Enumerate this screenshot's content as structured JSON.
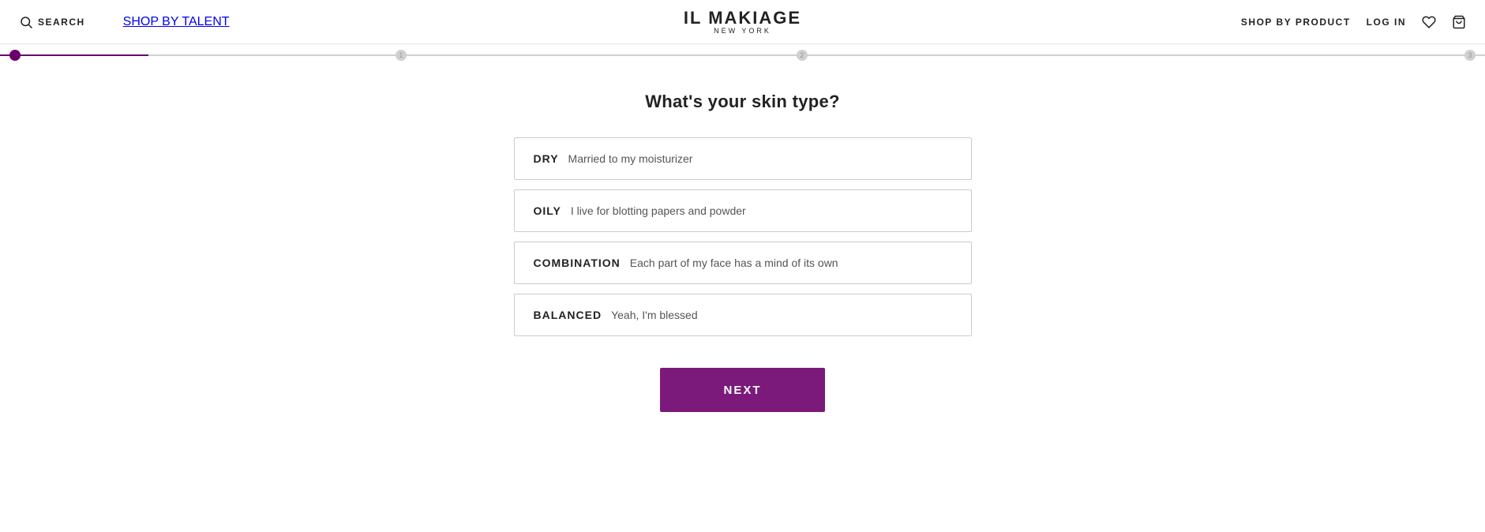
{
  "header": {
    "search_label": "SEARCH",
    "nav_left": {
      "shop_by_talent": "SHOP BY TALENT"
    },
    "brand": {
      "name": "IL MAKIAGE",
      "sub": "NEW YORK"
    },
    "nav_right": {
      "shop_by_product": "SHOP BY PRODUCT"
    },
    "actions": {
      "login": "LOG IN"
    }
  },
  "progress": {
    "steps": [
      {
        "id": 1,
        "active": true,
        "label": ""
      },
      {
        "id": 2,
        "active": false,
        "label": "1"
      },
      {
        "id": 3,
        "active": false,
        "label": "2"
      },
      {
        "id": 4,
        "active": false,
        "label": "3"
      }
    ],
    "fill_percent": "10%"
  },
  "page": {
    "title": "What's your skin type?"
  },
  "options": [
    {
      "type": "DRY",
      "description": "Married to my moisturizer"
    },
    {
      "type": "OILY",
      "description": "I live for blotting papers and powder"
    },
    {
      "type": "COMBINATION",
      "description": "Each part of my face has a mind of its own"
    },
    {
      "type": "BALANCED",
      "description": "Yeah, I'm blessed"
    }
  ],
  "next_button": {
    "label": "Next"
  }
}
